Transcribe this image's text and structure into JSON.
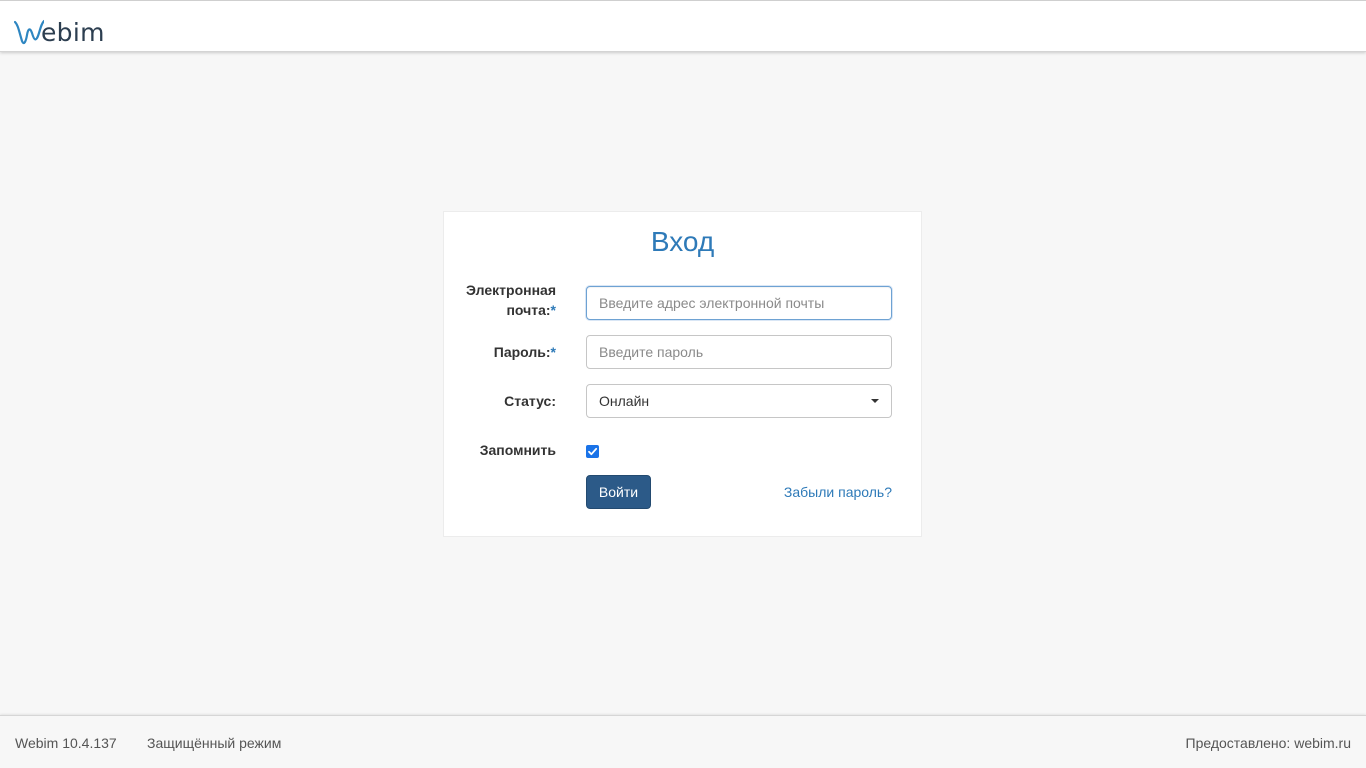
{
  "header": {
    "logo_text": "ebim"
  },
  "login": {
    "title": "Вход",
    "email_label": "Электронная",
    "email_label_line2": "почта:",
    "required_mark": "*",
    "email_placeholder": "Введите адрес электронной почты",
    "email_value": "",
    "password_label": "Пароль:",
    "password_placeholder": "Введите пароль",
    "password_value": "",
    "status_label": "Статус:",
    "status_value": "Онлайн",
    "remember_label": "Запомнить",
    "remember_checked": true,
    "submit_label": "Войти",
    "forgot_link": "Забыли пароль?"
  },
  "footer": {
    "version": "Webim 10.4.137",
    "mode": "Защищённый режим",
    "provided": "Предоставлено: webim.ru"
  },
  "colors": {
    "accent": "#2e7ab8",
    "button": "#2c5a88",
    "checkbox": "#1a73e8"
  }
}
